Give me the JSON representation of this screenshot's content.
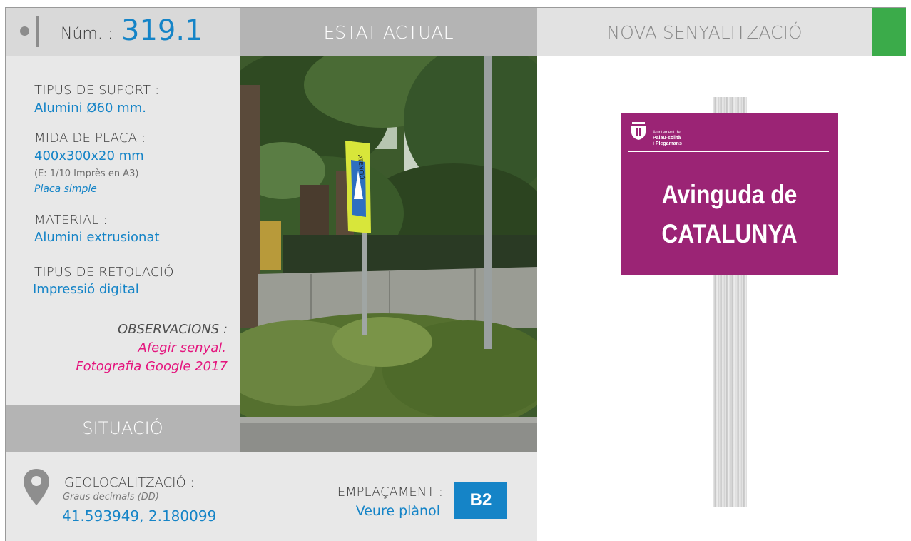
{
  "header": {
    "num_label": "Núm. :",
    "num_value": "319.1",
    "estat_label": "ESTAT ACTUAL",
    "nova_label": "NOVA SENYALITZACIÓ",
    "accent_color": "#3bab4a"
  },
  "specs": {
    "suport_label": "TIPUS DE SUPORT :",
    "suport_value": "Alumini Ø60 mm.",
    "mida_label": "MIDA DE PLACA :",
    "mida_value": "400x300x20 mm",
    "mida_note": "(E: 1/10 Imprès en A3)",
    "mida_type": "Placa simple",
    "material_label": "MATERIAL :",
    "material_value": "Alumini extrusionat",
    "retolacio_label": "TIPUS DE RETOLACIÓ :",
    "retolacio_value": "Impressió digital"
  },
  "observacions": {
    "label": "OBSERVACIONS :",
    "line1": "Afegir senyal.",
    "line2": "Fotografia Google 2017",
    "color": "#e4167e"
  },
  "situacio": {
    "label": "SITUACIÓ"
  },
  "geo": {
    "icon": "map-pin-icon",
    "label": "GEOLOCALITZACIÓ :",
    "sublabel": "Graus decimals (DD)",
    "value": "41.593949, 2.180099"
  },
  "emplacament": {
    "label": "EMPLAÇAMENT :",
    "link": "Veure plànol",
    "badge": "B2"
  },
  "sign": {
    "background_color": "#9b2475",
    "org_line1": "Ajuntament de",
    "org_line2": "Palau-solità",
    "org_line3": "i Plegamans",
    "street_line1": "Avinguda de",
    "street_line2": "CATALUNYA"
  },
  "photo": {
    "sign_text": "ATENCIÓ"
  }
}
